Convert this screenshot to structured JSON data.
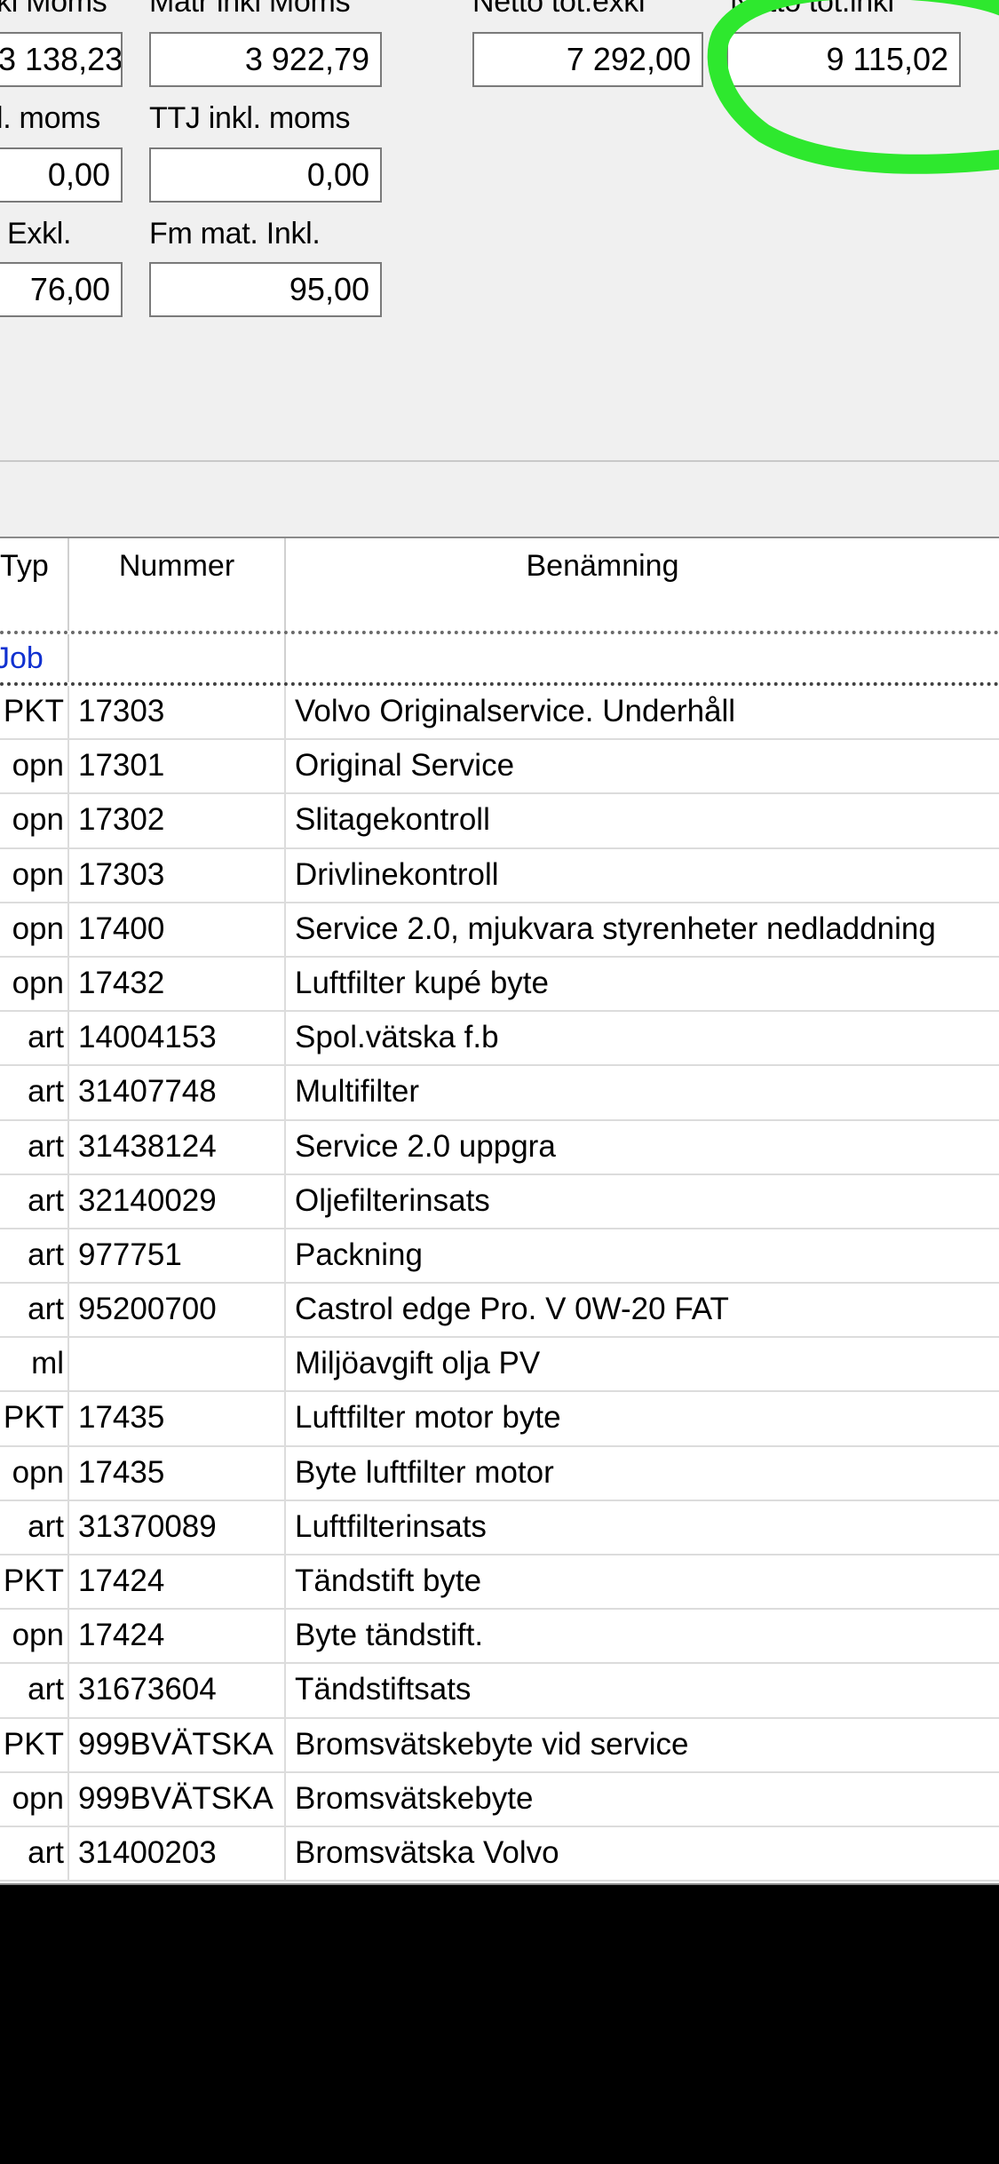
{
  "totals": {
    "labels": {
      "arb_inkl_moms": "kl Moms",
      "mat_inkl_moms": "Matr inkl Moms",
      "netto_tot_exkl": "Netto tot.exkl",
      "netto_tot_inkl": "Netto tot.inkl",
      "ttj_exkl_moms": "l. moms",
      "ttj_inkl_moms": "TTJ inkl. moms",
      "fm_mat_exkl": "Exkl.",
      "fm_mat_inkl": "Fm mat. Inkl."
    },
    "values": {
      "arb_inkl_moms": "3 138,23",
      "mat_inkl_moms": "3 922,79",
      "netto_tot_exkl": "7 292,00",
      "netto_tot_inkl": "9 115,02",
      "ttj_exkl_moms": "0,00",
      "ttj_inkl_moms": "0,00",
      "fm_mat_exkl": "76,00",
      "fm_mat_inkl": "95,00"
    }
  },
  "grid": {
    "columns": {
      "typ": "Typ",
      "nummer": "Nummer",
      "benamning": "Benämning"
    },
    "group_row": {
      "typ": "Job"
    },
    "rows": [
      {
        "typ": "PKT",
        "nummer": "17303",
        "benamning": "Volvo Originalservice. Underhåll"
      },
      {
        "typ": "opn",
        "nummer": "17301",
        "benamning": "Original Service"
      },
      {
        "typ": "opn",
        "nummer": "17302",
        "benamning": "Slitagekontroll"
      },
      {
        "typ": "opn",
        "nummer": "17303",
        "benamning": "Drivlinekontroll"
      },
      {
        "typ": "opn",
        "nummer": "17400",
        "benamning": "Service 2.0, mjukvara styrenheter nedladdning"
      },
      {
        "typ": "opn",
        "nummer": "17432",
        "benamning": "Luftfilter kupé byte"
      },
      {
        "typ": "art",
        "nummer": "14004153",
        "benamning": "Spol.vätska f.b"
      },
      {
        "typ": "art",
        "nummer": "31407748",
        "benamning": "Multifilter"
      },
      {
        "typ": "art",
        "nummer": "31438124",
        "benamning": "Service 2.0 uppgra"
      },
      {
        "typ": "art",
        "nummer": "32140029",
        "benamning": "Oljefilterinsats"
      },
      {
        "typ": "art",
        "nummer": "977751",
        "benamning": "Packning"
      },
      {
        "typ": "art",
        "nummer": "95200700",
        "benamning": "Castrol edge Pro. V 0W-20 FAT"
      },
      {
        "typ": "ml",
        "nummer": "",
        "benamning": "Miljöavgift olja PV"
      },
      {
        "typ": "PKT",
        "nummer": "17435",
        "benamning": "Luftfilter motor byte"
      },
      {
        "typ": "opn",
        "nummer": "17435",
        "benamning": "Byte luftfilter motor"
      },
      {
        "typ": "art",
        "nummer": "31370089",
        "benamning": "Luftfilterinsats"
      },
      {
        "typ": "PKT",
        "nummer": "17424",
        "benamning": "Tändstift byte"
      },
      {
        "typ": "opn",
        "nummer": "17424",
        "benamning": "Byte tändstift."
      },
      {
        "typ": "art",
        "nummer": "31673604",
        "benamning": "Tändstiftsats"
      },
      {
        "typ": "PKT",
        "nummer": "999BVÄTSKA",
        "benamning": "Bromsvätskebyte vid service"
      },
      {
        "typ": "opn",
        "nummer": "999BVÄTSKA",
        "benamning": "Bromsvätskebyte"
      },
      {
        "typ": "art",
        "nummer": "31400203",
        "benamning": "Bromsvätska Volvo"
      }
    ]
  },
  "annotation": {
    "color": "#2ee82e",
    "target": "netto_tot_inkl"
  }
}
